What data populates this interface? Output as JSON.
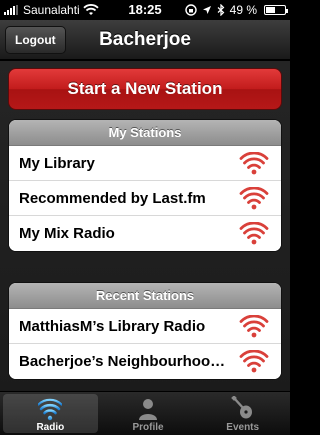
{
  "status_bar": {
    "carrier": "Saunalahti",
    "time": "18:25",
    "battery_percent": "49 %",
    "battery_level": 0.49
  },
  "nav": {
    "logout_label": "Logout",
    "title": "Bacherjoe"
  },
  "start_button": {
    "label": "Start a New Station"
  },
  "my_stations": {
    "header": "My Stations",
    "items": [
      {
        "label": "My Library",
        "icon": "wifi-signal-icon"
      },
      {
        "label": "Recommended by Last.fm",
        "icon": "wifi-signal-icon"
      },
      {
        "label": "My Mix Radio",
        "icon": "wifi-signal-icon"
      }
    ]
  },
  "recent_stations": {
    "header": "Recent Stations",
    "items": [
      {
        "label": "MatthiasM’s Library Radio",
        "icon": "wifi-signal-icon"
      },
      {
        "label": "Bacherjoe’s Neighbourhood Radio",
        "icon": "wifi-signal-icon"
      }
    ]
  },
  "tab_bar": {
    "tabs": [
      {
        "label": "Radio",
        "icon": "radio-waves-icon",
        "active": true
      },
      {
        "label": "Profile",
        "icon": "person-icon",
        "active": false
      },
      {
        "label": "Events",
        "icon": "guitar-icon",
        "active": false
      }
    ]
  },
  "colors": {
    "accent_red": "#c21c1c",
    "signal_icon_red": "#d9403a"
  }
}
